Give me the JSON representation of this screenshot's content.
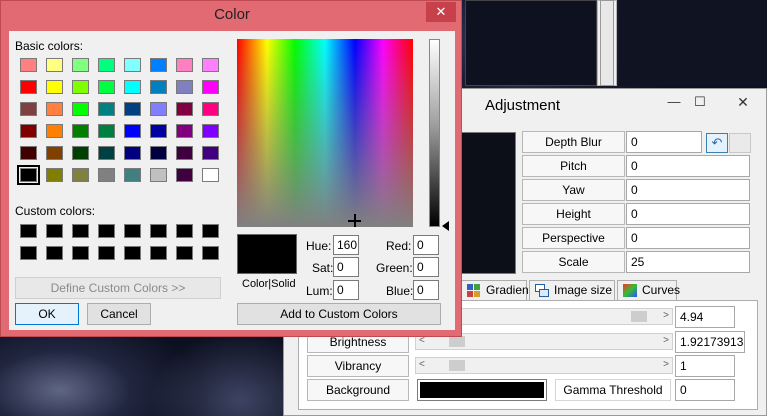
{
  "color_dialog": {
    "title": "Color",
    "close_glyph": "✕",
    "basic_colors_label": "Basic colors:",
    "basic_colors": [
      [
        "#ff8080",
        "#ffff80",
        "#80ff80",
        "#00ff80",
        "#80ffff",
        "#0080ff",
        "#ff80c0",
        "#ff80ff"
      ],
      [
        "#ff0000",
        "#ffff00",
        "#80ff00",
        "#00ff40",
        "#00ffff",
        "#0080c0",
        "#8080c0",
        "#ff00ff"
      ],
      [
        "#804040",
        "#ff8040",
        "#00ff00",
        "#008080",
        "#004080",
        "#8080ff",
        "#800040",
        "#ff0080"
      ],
      [
        "#800000",
        "#ff8000",
        "#008000",
        "#008040",
        "#0000ff",
        "#0000a0",
        "#800080",
        "#8000ff"
      ],
      [
        "#400000",
        "#804000",
        "#004000",
        "#004040",
        "#000080",
        "#000040",
        "#400040",
        "#400080"
      ],
      [
        "#000000",
        "#808000",
        "#808040",
        "#808080",
        "#408080",
        "#c0c0c0",
        "#400040",
        "#ffffff"
      ]
    ],
    "custom_colors_label": "Custom colors:",
    "define_custom_label": "Define Custom Colors >>",
    "ok_label": "OK",
    "cancel_label": "Cancel",
    "color_solid_label": "Color|Solid",
    "hue_label": "Hue:",
    "hue_value": "160",
    "sat_label": "Sat:",
    "sat_value": "0",
    "lum_label": "Lum:",
    "lum_value": "0",
    "red_label": "Red:",
    "red_value": "0",
    "green_label": "Green:",
    "green_value": "0",
    "blue_label": "Blue:",
    "blue_value": "0",
    "add_custom_label": "Add to Custom Colors"
  },
  "adjustment": {
    "title": "Adjustment",
    "minimize_glyph": "—",
    "maximize_glyph": "☐",
    "close_glyph": "✕",
    "undo_glyph": "↶",
    "properties": [
      {
        "label": "Depth Blur",
        "value": "0"
      },
      {
        "label": "Pitch",
        "value": "0"
      },
      {
        "label": "Yaw",
        "value": "0"
      },
      {
        "label": "Height",
        "value": "0"
      },
      {
        "label": "Perspective",
        "value": "0"
      },
      {
        "label": "Scale",
        "value": "25"
      }
    ],
    "tabs": [
      {
        "label": "Gradient",
        "icon": "grid-icon"
      },
      {
        "label": "Image size",
        "icon": "windows-icon"
      },
      {
        "label": "Curves",
        "icon": "curves-icon"
      }
    ],
    "sliders": [
      {
        "label": "",
        "value": "4.94",
        "level": 0.92
      },
      {
        "label": "Brightness",
        "value": "1.92173913",
        "level": 0.08
      },
      {
        "label": "Vibrancy",
        "value": "1",
        "level": 0.08
      }
    ],
    "background_label": "Background",
    "background_color": "#000000",
    "gamma_threshold_label": "Gamma Threshold",
    "gamma_threshold_value": "0"
  }
}
